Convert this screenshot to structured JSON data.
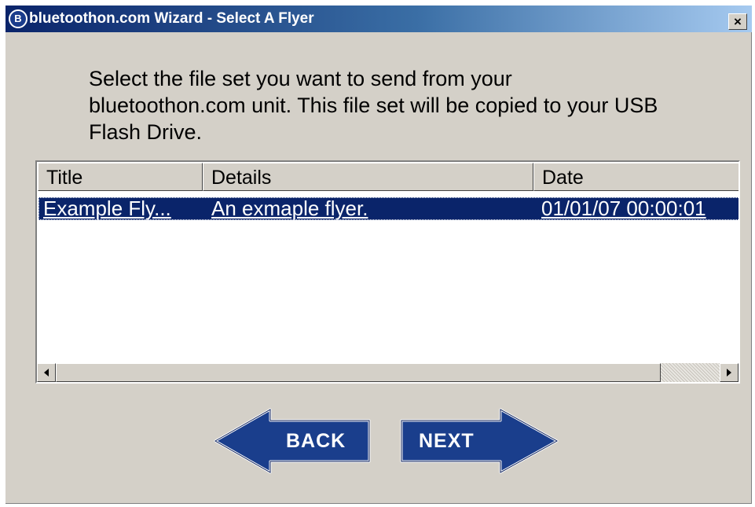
{
  "window": {
    "title": "bluetoothon.com Wizard - Select A Flyer",
    "app_icon_letter": "B",
    "close_glyph": "×"
  },
  "instruction": "Select the file set you want to send from your bluetoothon.com unit.  This file set will be copied to your USB Flash Drive.",
  "list": {
    "columns": [
      "Title",
      "Details",
      "Date"
    ],
    "rows": [
      {
        "title": "Example Fly...",
        "details": "An exmaple flyer.",
        "date": "01/01/07 00:00:01",
        "selected": true
      }
    ]
  },
  "scrollbar": {
    "left_glyph": "◀",
    "right_glyph": "▶"
  },
  "buttons": {
    "back": "BACK",
    "next": "NEXT"
  },
  "colors": {
    "dialog_bg": "#d4d0c8",
    "selection": "#0a246a",
    "button_fill": "#1a3e8c"
  }
}
